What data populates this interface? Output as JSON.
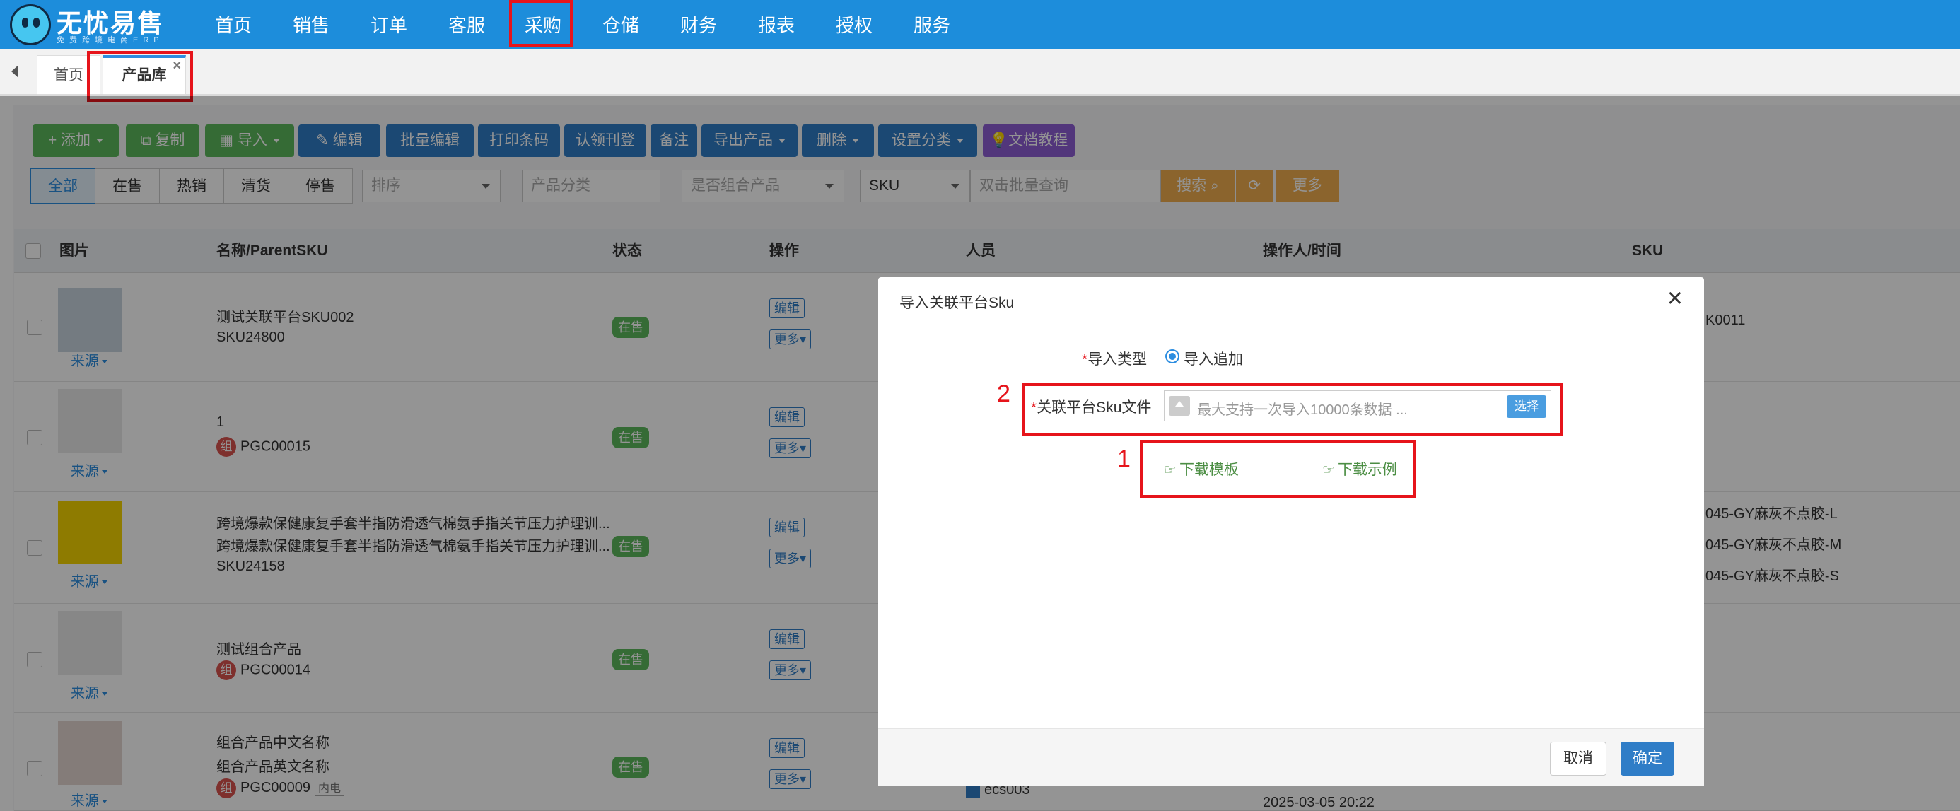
{
  "app": {
    "title": "无忧易售",
    "subtitle": "免费跨境电商ERP"
  },
  "nav": {
    "items": [
      {
        "label": "首页"
      },
      {
        "label": "销售"
      },
      {
        "label": "订单"
      },
      {
        "label": "客服"
      },
      {
        "label": "采购"
      },
      {
        "label": "仓储"
      },
      {
        "label": "财务"
      },
      {
        "label": "报表"
      },
      {
        "label": "授权"
      },
      {
        "label": "服务"
      }
    ],
    "active": "采购"
  },
  "tabs": {
    "home": "首页",
    "product": "产品库",
    "close": "×"
  },
  "toolbar": {
    "add": "添加",
    "copy": "复制",
    "import": "导入",
    "edit": "编辑",
    "batch_edit": "批量编辑",
    "print_barcode": "打印条码",
    "claim": "认领刊登",
    "remark": "备注",
    "export": "导出产品",
    "delete": "删除",
    "set_category": "设置分类",
    "docs": "文档教程"
  },
  "filters": {
    "status_tabs": [
      "全部",
      "在售",
      "热销",
      "清货",
      "停售"
    ],
    "sort_placeholder": "排序",
    "category_placeholder": "产品分类",
    "combo_placeholder": "是否组合产品",
    "sku_select": "SKU",
    "batch_query_placeholder": "双击批量查询",
    "search": "搜索",
    "more": "更多"
  },
  "table": {
    "headers": {
      "image": "图片",
      "name": "名称/ParentSKU",
      "status": "状态",
      "ops": "操作",
      "person": "人员",
      "operator_time": "操作人/时间",
      "sku": "SKU"
    },
    "source_label": "来源",
    "op_edit": "编辑",
    "op_more": "更多",
    "rows": [
      {
        "line1": "测试关联平台SKU002",
        "line2": "SKU24800",
        "status": "在售",
        "sku1": "K0011"
      },
      {
        "line1": "1",
        "line2": "PGC00015",
        "status": "在售"
      },
      {
        "line1": "跨境爆款保健康复手套半指防滑透气棉氨手指关节压力护理训...",
        "line2": "跨境爆款保健康复手套半指防滑透气棉氨手指关节压力护理训...",
        "line3": "SKU24158",
        "status": "在售",
        "sku1": "045-GY麻灰不点胶-L",
        "sku2": "045-GY麻灰不点胶-M",
        "sku3": "045-GY麻灰不点胶-S"
      },
      {
        "line1": "测试组合产品",
        "line2": "PGC00014",
        "status": "在售"
      },
      {
        "line1": "组合产品中文名称",
        "line2": "组合产品英文名称",
        "line3": "PGC00009",
        "tag": "内电",
        "status": "在售",
        "person": "ecs003",
        "time": "2025-03-05 20:22"
      }
    ],
    "combo_badge": "组"
  },
  "modal": {
    "title": "导入关联平台Sku",
    "close": "×",
    "import_type_label": "导入类型",
    "import_type_option": "导入追加",
    "file_label": "关联平台Sku文件",
    "file_placeholder": "最大支持一次导入10000条数据 ...",
    "choose": "选择",
    "download_template": "下载模板",
    "download_example": "下载示例",
    "cancel": "取消",
    "confirm": "确定",
    "required_mark": "*"
  },
  "annotations": {
    "one": "1",
    "two": "2"
  },
  "colors": {
    "nav_bg": "#1d8ddb",
    "highlight": "#e6141b",
    "primary": "#2f7dc7",
    "success": "#5cb85c",
    "link_green": "#4c8e44"
  }
}
